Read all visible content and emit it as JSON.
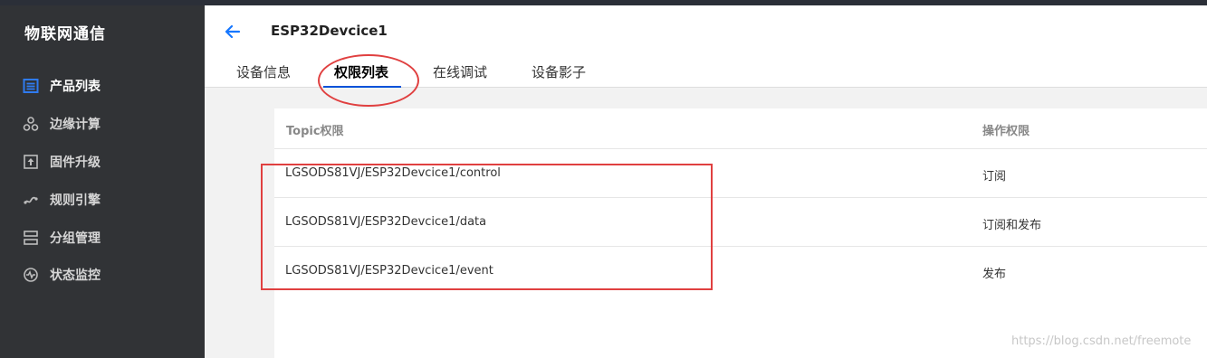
{
  "app": {
    "brand": "物联网通信"
  },
  "sidebar": {
    "items": [
      {
        "label": "产品列表",
        "icon": "product-list-icon",
        "active": true
      },
      {
        "label": "边缘计算",
        "icon": "edge-compute-icon"
      },
      {
        "label": "固件升级",
        "icon": "firmware-upgrade-icon"
      },
      {
        "label": "规则引擎",
        "icon": "rule-engine-icon"
      },
      {
        "label": "分组管理",
        "icon": "group-manage-icon"
      },
      {
        "label": "状态监控",
        "icon": "status-monitor-icon"
      }
    ]
  },
  "header": {
    "title": "ESP32Devcice1",
    "tabs": [
      {
        "label": "设备信息"
      },
      {
        "label": "权限列表",
        "active": true
      },
      {
        "label": "在线调试"
      },
      {
        "label": "设备影子"
      }
    ]
  },
  "table": {
    "columns": [
      "Topic权限",
      "操作权限"
    ],
    "rows": [
      {
        "topic": "LGSODS81VJ/ESP32Devcice1/control",
        "permission": "订阅"
      },
      {
        "topic": "LGSODS81VJ/ESP32Devcice1/data",
        "permission": "订阅和发布"
      },
      {
        "topic": "LGSODS81VJ/ESP32Devcice1/event",
        "permission": "发布"
      }
    ]
  },
  "watermark": "https://blog.csdn.net/freemote",
  "colors": {
    "sidebar_bg": "#313336",
    "accent": "#0052d9",
    "annotation": "#e04040"
  }
}
